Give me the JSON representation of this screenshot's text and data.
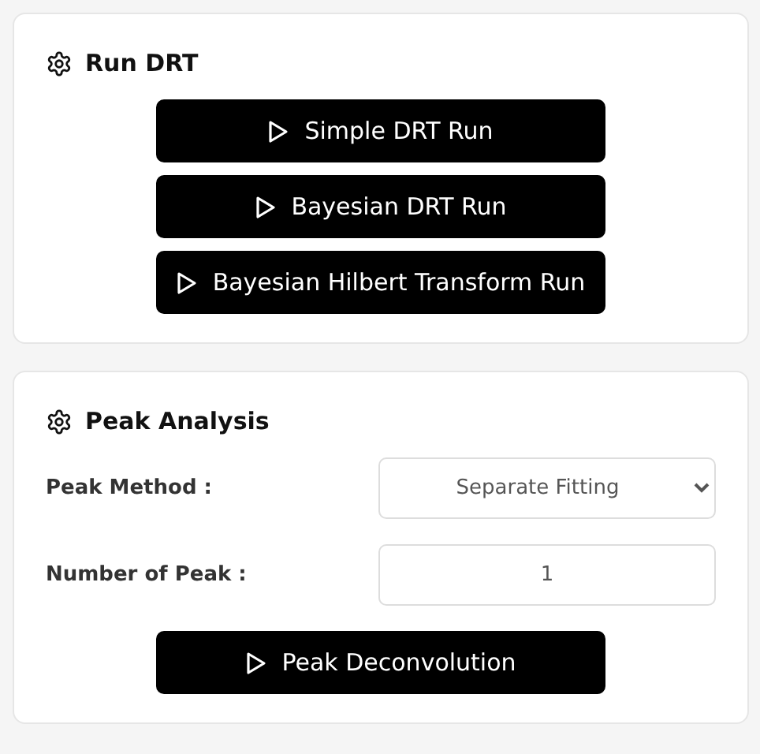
{
  "sections": [
    {
      "title": "Run DRT",
      "buttons": [
        "Simple DRT Run",
        "Bayesian DRT Run",
        "Bayesian Hilbert Transform Run"
      ]
    },
    {
      "title": "Peak Analysis",
      "fields": [
        {
          "kind": "select",
          "label": "Peak Method :",
          "value": "Separate Fitting"
        },
        {
          "kind": "input",
          "label": "Number of Peak :",
          "value": "1"
        }
      ],
      "buttons": [
        "Peak Deconvolution"
      ]
    }
  ]
}
